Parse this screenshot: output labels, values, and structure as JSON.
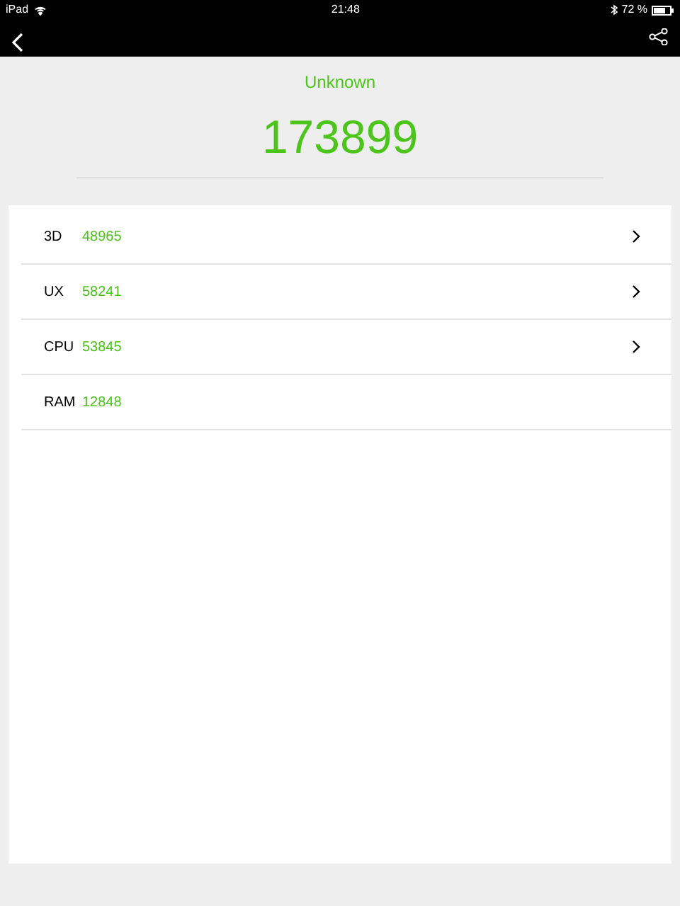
{
  "status_bar": {
    "device": "iPad",
    "time": "21:48",
    "battery": "72 %"
  },
  "header": {
    "title": "Unknown",
    "score": "173899"
  },
  "rows": [
    {
      "label": "3D",
      "value": "48965",
      "expandable": true
    },
    {
      "label": "UX",
      "value": "58241",
      "expandable": true
    },
    {
      "label": "CPU",
      "value": "53845",
      "expandable": true
    },
    {
      "label": "RAM",
      "value": "12848",
      "expandable": false
    }
  ]
}
